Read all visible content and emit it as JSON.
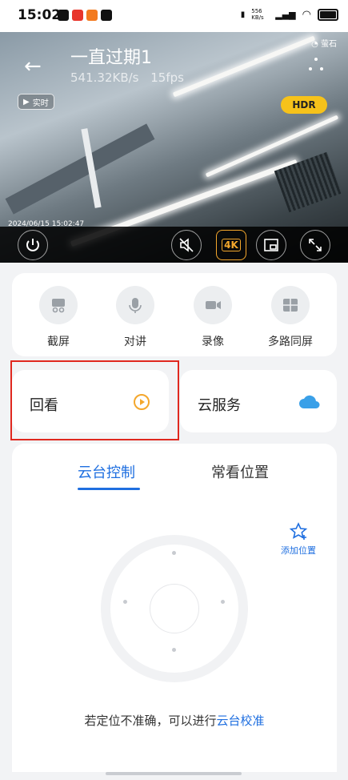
{
  "status_bar": {
    "time": "15:02",
    "net_speed": "556 KB/s"
  },
  "player": {
    "title": "一直过期1",
    "bitrate": "541.32KB/s",
    "fps": "15fps",
    "live_label": "实时",
    "hdr_label": "HDR",
    "timestamp": "2024/06/15 15:02:47",
    "quality_label": "4K",
    "logo_text": "萤石"
  },
  "tools": [
    {
      "label": "截屏",
      "icon": "scissors-icon"
    },
    {
      "label": "对讲",
      "icon": "microphone-icon"
    },
    {
      "label": "录像",
      "icon": "video-camera-icon"
    },
    {
      "label": "多路同屏",
      "icon": "multi-screen-icon"
    }
  ],
  "tiles": {
    "playback": {
      "label": "回看",
      "icon": "playback-icon",
      "accent": "#f4a72c"
    },
    "cloud": {
      "label": "云服务",
      "icon": "cloud-icon",
      "accent": "#3aa0e8"
    }
  },
  "ptz": {
    "tab_active": "云台控制",
    "tab_other": "常看位置",
    "add_position": "添加位置",
    "hint_prefix": "若定位不准确，可以进行",
    "hint_link": "云台校准"
  },
  "colors": {
    "accent_blue": "#1f6fe0",
    "highlight_red": "#e0281f"
  }
}
